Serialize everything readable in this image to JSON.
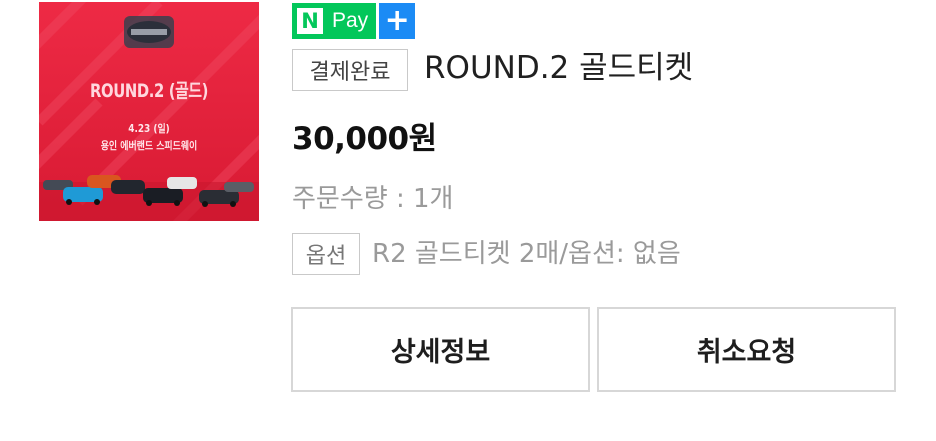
{
  "product": {
    "thumbnail": {
      "title": "ROUND.2 (골드)",
      "date": "4.23 (일)",
      "venue": "용인 에버랜드 스피드웨이",
      "background_color": "#e51f3b"
    },
    "payment_badge": {
      "n_label": "N",
      "pay_label": "Pay",
      "plus_label": "+",
      "green": "#03c75a",
      "blue": "#1b8bf5"
    },
    "status": "결제완료",
    "name": "ROUND.2 골드티켓",
    "price": "30,000원",
    "quantity": "주문수량 : 1개",
    "option_label": "옵션",
    "option_value": "R2 골드티켓 2매/옵션: 없음"
  },
  "actions": {
    "detail_label": "상세정보",
    "cancel_label": "취소요청"
  }
}
